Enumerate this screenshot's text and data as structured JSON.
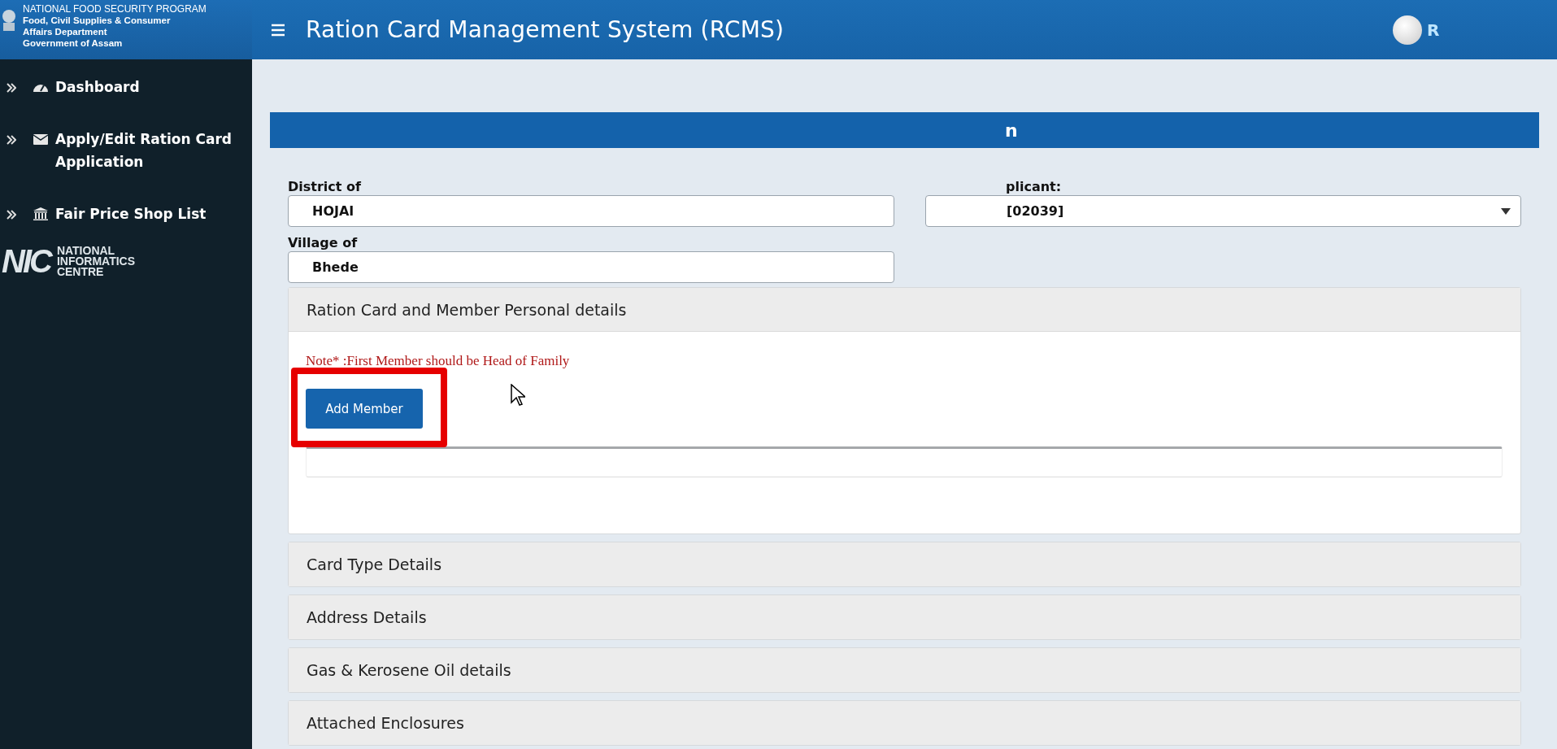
{
  "header": {
    "org_lines": [
      "NATIONAL FOOD SECURITY PROGRAM",
      "Food, Civil Supplies & Consumer",
      "Affairs Department",
      "Government of Assam"
    ],
    "title": "Ration Card Management System (RCMS)",
    "user_name": "R"
  },
  "sidebar": {
    "items": [
      {
        "label": "Dashboard",
        "kind": "dashboard"
      },
      {
        "label": "Apply/Edit Ration Card Application",
        "kind": "mail"
      },
      {
        "label": "Fair Price Shop List",
        "kind": "bank"
      }
    ],
    "logo": {
      "mark": "NIC",
      "lines": [
        "NATIONAL",
        "INFORMATICS",
        "CENTRE"
      ]
    }
  },
  "form": {
    "title": "n",
    "fields": [
      {
        "label": "District of",
        "value": "HOJAI",
        "kind": "text"
      },
      {
        "label": "plicant:",
        "value": "[02039]",
        "kind": "select"
      },
      {
        "label": "Village of",
        "value": "Bhede",
        "kind": "text"
      }
    ],
    "sections": [
      {
        "title": "Ration Card and Member Personal details",
        "expanded": true,
        "note": "Note* :First Member should be Head of Family",
        "button": "Add Member"
      },
      {
        "title": "Card Type Details",
        "expanded": false
      },
      {
        "title": "Address Details",
        "expanded": false
      },
      {
        "title": "Gas & Kerosene Oil details",
        "expanded": false
      },
      {
        "title": "Attached Enclosures",
        "expanded": false
      }
    ]
  }
}
